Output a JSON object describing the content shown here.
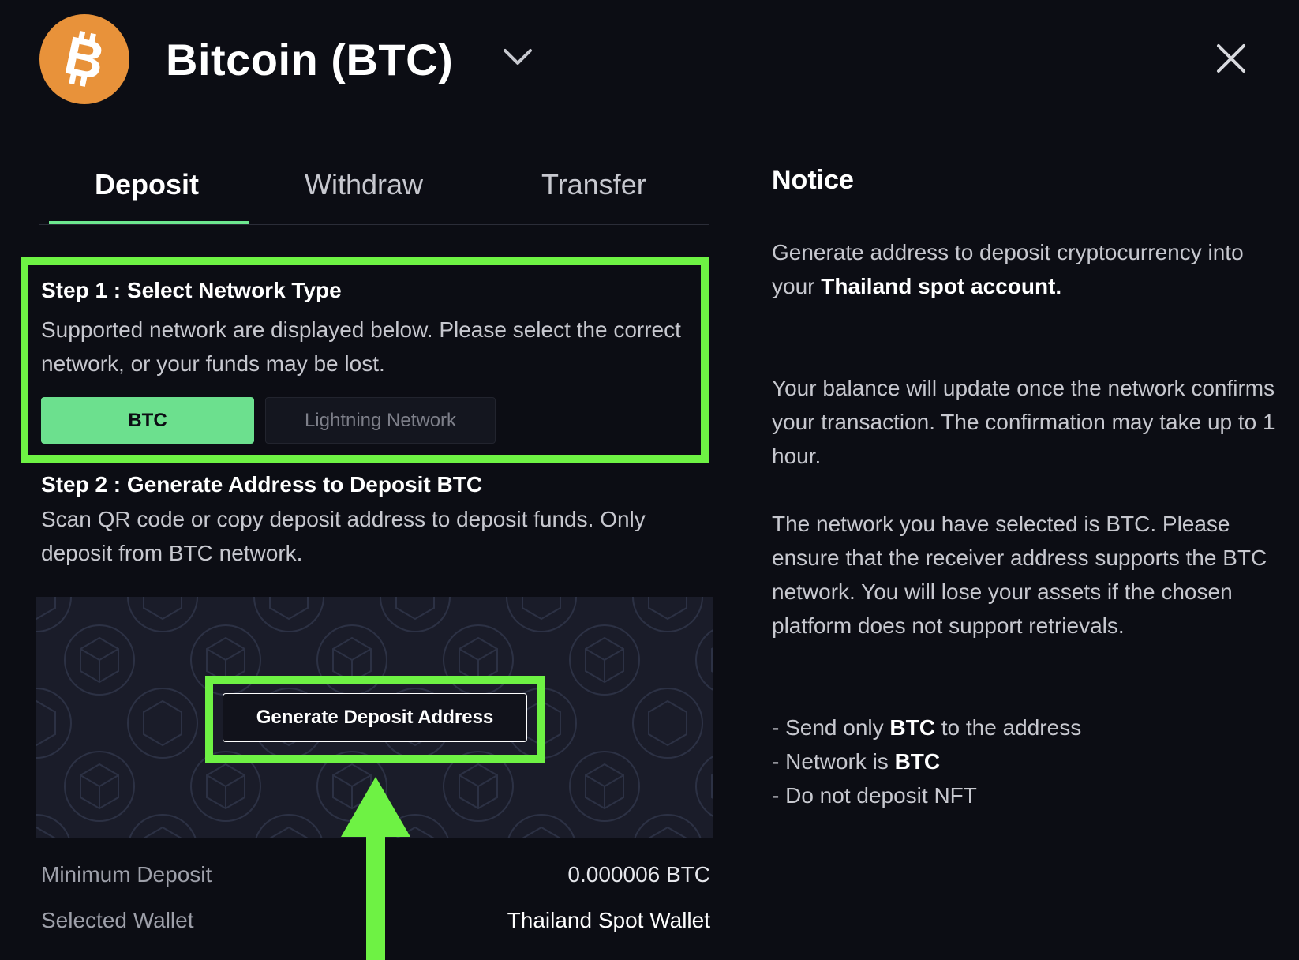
{
  "header": {
    "coin_title": "Bitcoin (BTC)",
    "coin_icon": "bitcoin-logo-icon",
    "dropdown_icon": "chevron-down-icon",
    "close_icon": "close-icon",
    "brand_color": "#e8923a"
  },
  "tabs": [
    {
      "label": "Deposit",
      "active": true
    },
    {
      "label": "Withdraw",
      "active": false
    },
    {
      "label": "Transfer",
      "active": false
    }
  ],
  "step1": {
    "title": "Step 1 : Select Network Type",
    "description": "Supported network are displayed below. Please select the correct network, or your funds may be lost.",
    "networks": [
      {
        "label": "BTC",
        "selected": true
      },
      {
        "label": "Lightning Network",
        "selected": false
      }
    ]
  },
  "step2": {
    "title": "Step 2 : Generate Address to Deposit BTC",
    "description": "Scan QR code or copy deposit address to deposit funds. Only deposit from BTC network.",
    "generate_button": "Generate Deposit Address"
  },
  "info": {
    "min_deposit_label": "Minimum Deposit",
    "min_deposit_value": "0.000006 BTC",
    "wallet_label": "Selected Wallet",
    "wallet_value": "Thailand Spot Wallet"
  },
  "notice": {
    "title": "Notice",
    "p1_pre": "Generate address to deposit cryptocurrency into your ",
    "p1_bold": "Thailand spot account.",
    "p2": "Your balance will update once the network confirms your transaction. The confirmation may take up to 1 hour.",
    "p3": "The network you have selected is BTC. Please ensure that the receiver address supports the BTC network. You will lose your assets if the chosen platform does not support retrievals.",
    "list": [
      {
        "pre": "- Send only ",
        "bold": "BTC",
        "post": " to the address"
      },
      {
        "pre": "- Network is ",
        "bold": "BTC",
        "post": ""
      },
      {
        "pre": "- Do not deposit NFT",
        "bold": "",
        "post": ""
      }
    ]
  },
  "colors": {
    "accent_green": "#6ce08e",
    "highlight_green": "#6ef244",
    "background": "#0c0d14"
  }
}
